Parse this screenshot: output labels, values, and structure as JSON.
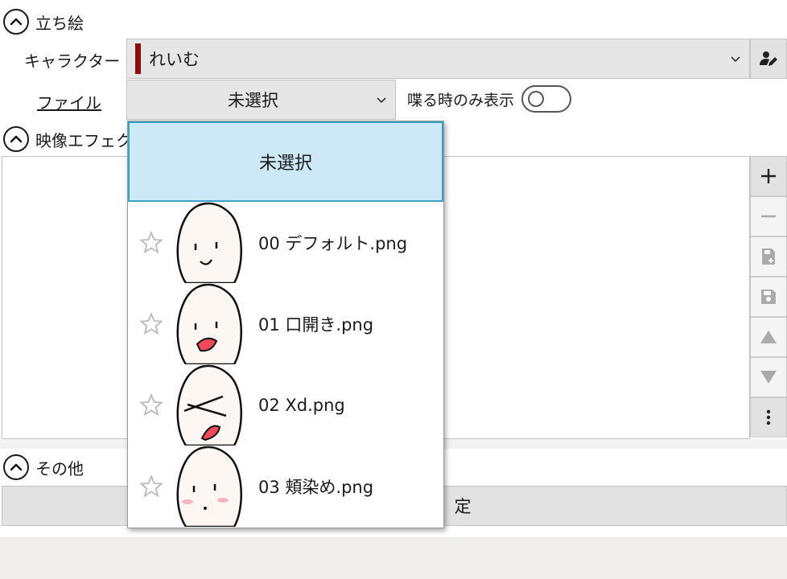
{
  "sections": {
    "standing": "立ち絵",
    "video_effects": "映像エフェクト",
    "other": "その他"
  },
  "character": {
    "label": "キャラクター",
    "value": "れいむ",
    "bar_color": "#8b0d0d"
  },
  "file": {
    "label": "ファイル",
    "value": "未選択"
  },
  "speak_only": {
    "label": "喋る時のみ表示",
    "on": false
  },
  "bottom_button": {
    "visible_text": "定"
  },
  "dropdown": {
    "selected": "未選択",
    "items": [
      {
        "name": "00 デフォルト.png",
        "icon": "star-outline-icon",
        "face": "smile"
      },
      {
        "name": "01 口開き.png",
        "icon": "star-outline-icon",
        "face": "open-mouth"
      },
      {
        "name": "02 Xd.png",
        "icon": "star-outline-icon",
        "face": "xd"
      },
      {
        "name": "03 頬染め.png",
        "icon": "star-outline-icon",
        "face": "blush"
      }
    ]
  },
  "side_buttons": [
    {
      "icon": "plus-icon",
      "enabled": true
    },
    {
      "icon": "minus-icon",
      "enabled": false
    },
    {
      "icon": "save-add-icon",
      "enabled": false
    },
    {
      "icon": "save-icon",
      "enabled": false
    },
    {
      "icon": "arrow-up-icon",
      "enabled": false
    },
    {
      "icon": "arrow-down-icon",
      "enabled": false
    },
    {
      "icon": "more-vertical-icon",
      "enabled": true
    }
  ],
  "colors": {
    "selection_bg": "#cde8f6",
    "selection_border": "#3aa0c8"
  }
}
